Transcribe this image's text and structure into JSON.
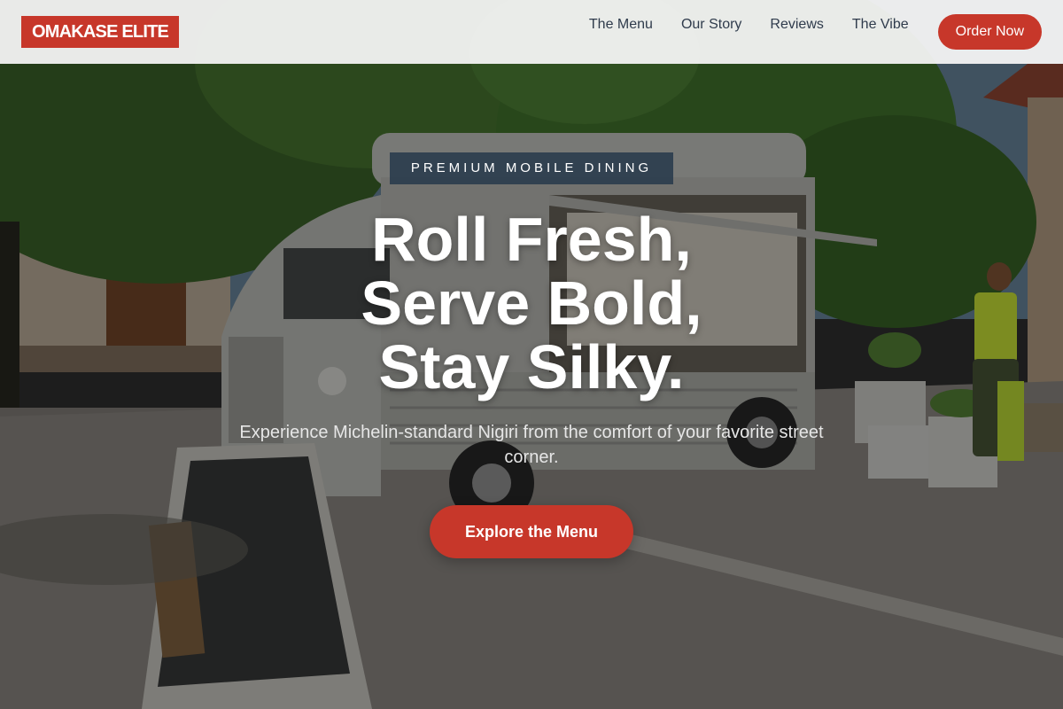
{
  "header": {
    "brand": "OMAKASE ELITE",
    "nav": [
      {
        "label": "The Menu"
      },
      {
        "label": "Our Story"
      },
      {
        "label": "Reviews"
      },
      {
        "label": "The Vibe"
      }
    ],
    "order_label": "Order Now"
  },
  "hero": {
    "eyebrow": "PREMIUM MOBILE DINING",
    "headline_lines": [
      "Roll Fresh,",
      "Serve Bold,",
      "Stay Silky."
    ],
    "subtitle": "Experience Michelin-standard Nigiri from the comfort of your favorite street corner.",
    "cta_label": "Explore the Menu"
  },
  "colors": {
    "accent": "#c7372a",
    "nav_text": "#2f3b4c",
    "eyebrow_bg": "#283a4c"
  }
}
